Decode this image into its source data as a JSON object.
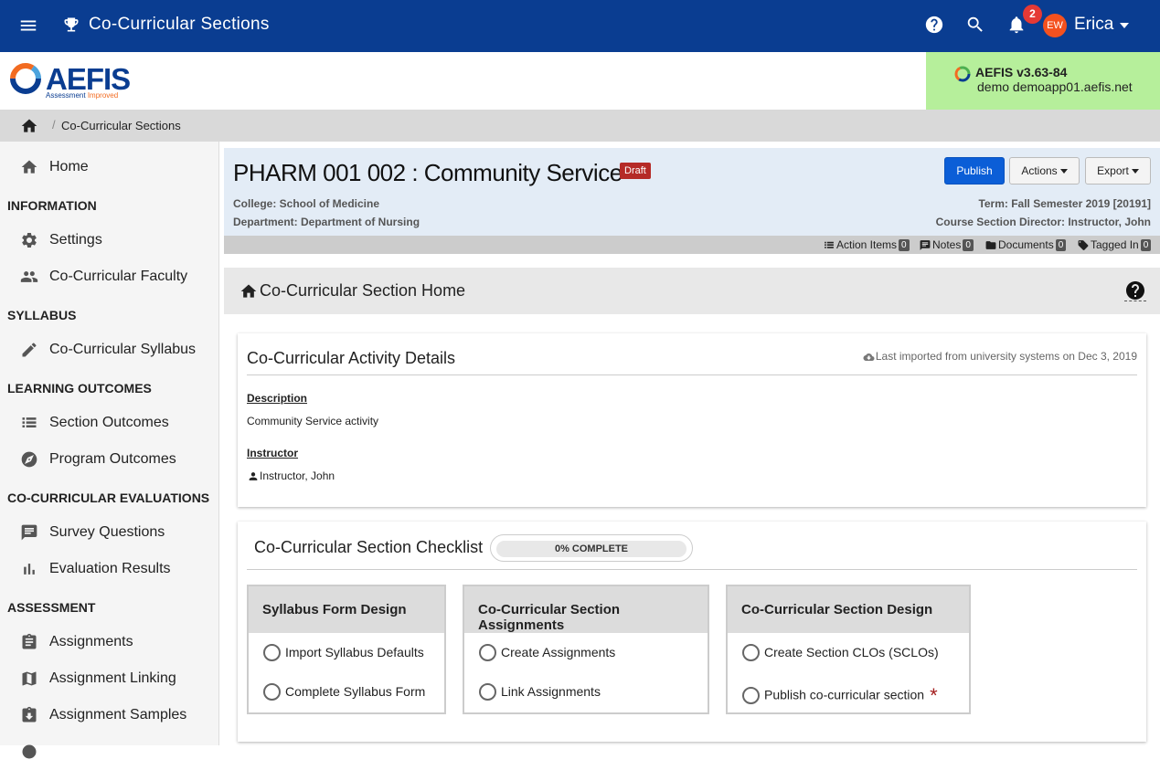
{
  "topbar": {
    "title": "Co-Curricular Sections",
    "notification_count": "2",
    "avatar_initials": "EW",
    "user_name": "Erica"
  },
  "logo": {
    "name": "AEFIS",
    "tagline_a": "Assessment",
    "tagline_b": "Improved"
  },
  "version": {
    "label": "AEFIS v3.63-84",
    "server": "demo demoapp01.aefis.net"
  },
  "breadcrumb": {
    "current": "Co-Curricular Sections"
  },
  "sidebar": {
    "home": "Home",
    "sections": [
      {
        "heading": "INFORMATION",
        "items": [
          "Settings",
          "Co-Curricular Faculty"
        ]
      },
      {
        "heading": "SYLLABUS",
        "items": [
          "Co-Curricular Syllabus"
        ]
      },
      {
        "heading": "LEARNING OUTCOMES",
        "items": [
          "Section Outcomes",
          "Program Outcomes"
        ]
      },
      {
        "heading": "CO-CURRICULAR EVALUATIONS",
        "items": [
          "Survey Questions",
          "Evaluation Results"
        ]
      },
      {
        "heading": "ASSESSMENT",
        "items": [
          "Assignments",
          "Assignment Linking",
          "Assignment Samples"
        ]
      }
    ]
  },
  "header": {
    "title": "PHARM 001 002 : Community Service",
    "status": "Draft",
    "college": "College: School of Medicine",
    "department": "Department: Department of Nursing",
    "term": "Term: Fall Semester 2019 [20191]",
    "director": "Course Section Director: Instructor, John",
    "publish_label": "Publish",
    "actions_label": "Actions",
    "export_label": "Export"
  },
  "toolbar": {
    "action_items": "Action Items",
    "action_items_count": "0",
    "notes": "Notes",
    "notes_count": "0",
    "documents": "Documents",
    "documents_count": "0",
    "tagged_in": "Tagged In",
    "tagged_in_count": "0"
  },
  "section_home": {
    "title": "Co-Curricular Section Home"
  },
  "details": {
    "title": "Co-Curricular Activity Details",
    "imported": "Last imported from university systems on Dec 3, 2019",
    "description_label": "Description",
    "description": "Community Service activity",
    "instructor_label": "Instructor",
    "instructor": "Instructor, John"
  },
  "checklist": {
    "title": "Co-Curricular Section Checklist",
    "progress_text": "0% COMPLETE",
    "progress": 0,
    "groups": [
      {
        "title": "Syllabus Form Design",
        "items": [
          "Import Syllabus Defaults",
          "Complete Syllabus Form"
        ]
      },
      {
        "title": "Co-Curricular Section Assignments",
        "items": [
          "Create Assignments",
          "Link Assignments"
        ]
      },
      {
        "title": "Co-Curricular Section Design",
        "items": [
          "Create Section CLOs (SCLOs)",
          "Publish co-curricular section"
        ]
      }
    ],
    "required_marker": "*"
  },
  "colors": {
    "topbar": "#0a3d91",
    "version_bg": "#b6ef9b",
    "publish": "#0b5ed7",
    "draft": "#b52b27",
    "notification": "#e53935",
    "avatar": "#f4511e"
  }
}
